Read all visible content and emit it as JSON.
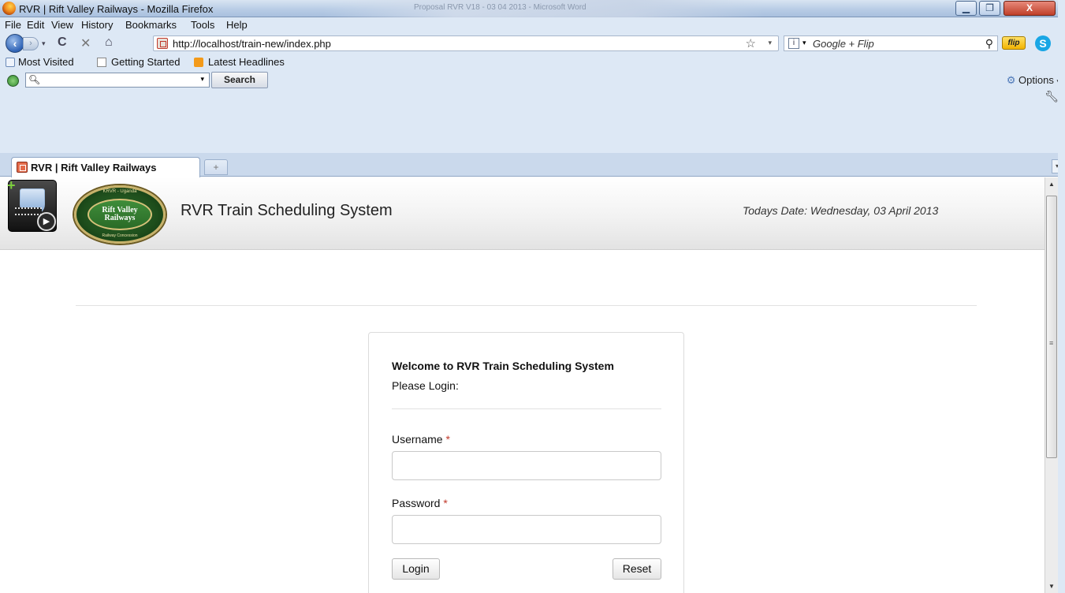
{
  "window": {
    "title": "RVR | Rift Valley Railways - Mozilla Firefox",
    "background_doc_title": "Proposal RVR V18 - 03 04 2013 - Microsoft Word"
  },
  "menu": [
    "File",
    "Edit",
    "View",
    "History",
    "Bookmarks",
    "Tools",
    "Help"
  ],
  "nav": {
    "url": "http://localhost/train-new/index.php",
    "search_engine_placeholder": "Google + Flip",
    "flip_label": "flip"
  },
  "bookmarks": [
    "Most Visited",
    "Getting Started",
    "Latest Headlines"
  ],
  "toolbar": {
    "search_button": "Search",
    "options_label": "Options"
  },
  "tabs": [
    {
      "label": "RVR | Rift Valley Railways"
    }
  ],
  "app": {
    "logo_text_line1": "Rift Valley",
    "logo_text_line2": "Railways",
    "logo_arc_top": "KRVR - Uganda",
    "logo_arc_bottom": "Railway Concession",
    "title": "RVR Train Scheduling System",
    "date": "Todays Date: Wednesday, 03 April 2013"
  },
  "login": {
    "heading": "Welcome to RVR Train Scheduling System",
    "subheading": "Please Login:",
    "username_label": "Username",
    "password_label": "Password",
    "required_marker": "*",
    "username_value": "",
    "password_value": "",
    "login_button": "Login",
    "reset_button": "Reset"
  },
  "colors": {
    "required": "#c0392b",
    "chrome_bg": "#dde8f5"
  }
}
